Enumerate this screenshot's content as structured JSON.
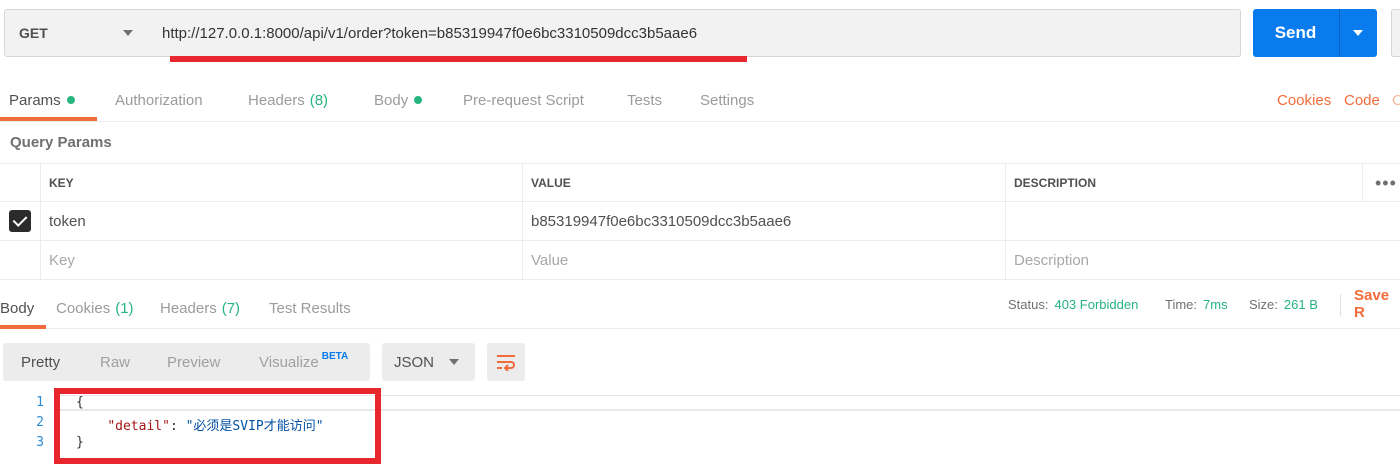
{
  "request": {
    "method": "GET",
    "url": "http://127.0.0.1:8000/api/v1/order?token=b85319947f0e6bc3310509dcc3b5aae6",
    "send_label": "Send"
  },
  "request_tabs": [
    {
      "label": "Params",
      "dot": true
    },
    {
      "label": "Authorization"
    },
    {
      "label": "Headers",
      "count": "(8)"
    },
    {
      "label": "Body",
      "dot": true
    },
    {
      "label": "Pre-request Script"
    },
    {
      "label": "Tests"
    },
    {
      "label": "Settings"
    }
  ],
  "right_links": {
    "cookies": "Cookies",
    "code": "Code",
    "cut": "C"
  },
  "query_params": {
    "title": "Query Params",
    "columns": [
      "KEY",
      "VALUE",
      "DESCRIPTION"
    ],
    "more": "•••",
    "rows": [
      {
        "checked": true,
        "key": "token",
        "value": "b85319947f0e6bc3310509dcc3b5aae6",
        "description": ""
      }
    ],
    "placeholders": {
      "key": "Key",
      "value": "Value",
      "description": "Description"
    }
  },
  "response_tabs": [
    {
      "label": "Body"
    },
    {
      "label": "Cookies",
      "count": "(1)"
    },
    {
      "label": "Headers",
      "count": "(7)"
    },
    {
      "label": "Test Results"
    }
  ],
  "response_status": {
    "status_label": "Status:",
    "status_value": "403 Forbidden",
    "time_label": "Time:",
    "time_value": "7ms",
    "size_label": "Size:",
    "size_value": "261 B",
    "save_label": "Save R"
  },
  "view_modes": {
    "pretty": "Pretty",
    "raw": "Raw",
    "preview": "Preview",
    "visualize": "Visualize",
    "beta": "BETA"
  },
  "format": "JSON",
  "code": {
    "line_numbers": [
      "1",
      "2",
      "3"
    ],
    "open_brace": "{",
    "key": "\"detail\"",
    "colon": ": ",
    "value": "\"必须是SVIP才能访问\"",
    "close_brace": "}"
  },
  "colors": {
    "accent": "#f26b3a",
    "send": "#097bed",
    "success": "#26b47f",
    "annotation": "#e8262d"
  }
}
